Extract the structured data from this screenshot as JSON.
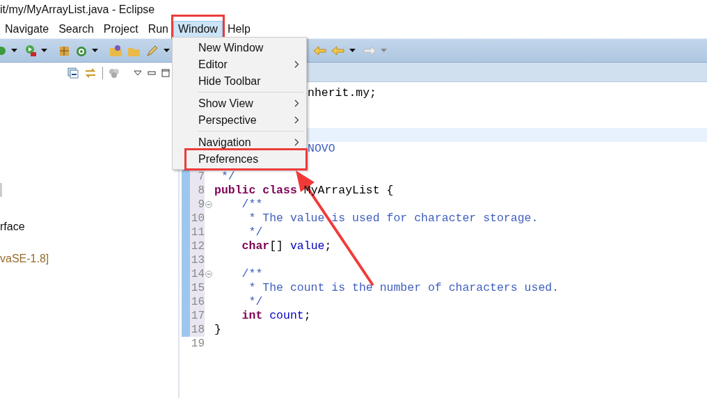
{
  "window": {
    "title": "it/my/MyArrayList.java - Eclipse"
  },
  "menu_bar": [
    {
      "label": "Navigate",
      "selected": false,
      "highlighted": false
    },
    {
      "label": "Search",
      "selected": false,
      "highlighted": false
    },
    {
      "label": "Project",
      "selected": false,
      "highlighted": false
    },
    {
      "label": "Run",
      "selected": false,
      "highlighted": false
    },
    {
      "label": "Window",
      "selected": true,
      "highlighted": true
    },
    {
      "label": "Help",
      "selected": false,
      "highlighted": false
    }
  ],
  "window_menu": [
    {
      "kind": "item",
      "label": "New Window",
      "submenu": false,
      "highlighted": false
    },
    {
      "kind": "item",
      "label": "Editor",
      "submenu": true,
      "highlighted": false
    },
    {
      "kind": "item",
      "label": "Hide Toolbar",
      "submenu": false,
      "highlighted": false
    },
    {
      "kind": "separator"
    },
    {
      "kind": "item",
      "label": "Show View",
      "submenu": true,
      "highlighted": false
    },
    {
      "kind": "item",
      "label": "Perspective",
      "submenu": true,
      "highlighted": false
    },
    {
      "kind": "separator"
    },
    {
      "kind": "item",
      "label": "Navigation",
      "submenu": true,
      "highlighted": false
    },
    {
      "kind": "item",
      "label": "Preferences",
      "submenu": false,
      "highlighted": true
    }
  ],
  "package_explorer": {
    "items": [
      {
        "label": "rface",
        "kind": "type"
      },
      {
        "label": "vaSE-1.8]",
        "kind": "library"
      }
    ]
  },
  "editor": {
    "lines": [
      {
        "current": false,
        "tokens": [
          {
            "t": "nherit.my;",
            "kind": "plain"
          }
        ]
      },
      {
        "current": false
      },
      {
        "current": false
      },
      {
        "current": true
      },
      {
        "current": false,
        "tokens": [
          {
            "t": "NOVO",
            "kind": "comment"
          }
        ]
      },
      {
        "current": false
      },
      {
        "number": "7",
        "current": false,
        "changed": true,
        "fold": false,
        "tokens": [
          {
            "t": " */",
            "kind": "comment"
          }
        ]
      },
      {
        "number": "8",
        "current": false,
        "changed": true,
        "fold": false,
        "tokens": [
          {
            "t": "public class",
            "kind": "kw"
          },
          {
            "t": " MyArrayList {",
            "kind": "plain"
          }
        ]
      },
      {
        "number": "9",
        "current": false,
        "changed": true,
        "fold": true,
        "tokens": [
          {
            "t": "    /**",
            "kind": "comment"
          }
        ]
      },
      {
        "number": "10",
        "current": false,
        "changed": true,
        "fold": false,
        "tokens": [
          {
            "t": "     * The value is used for character storage.",
            "kind": "comment"
          }
        ]
      },
      {
        "number": "11",
        "current": false,
        "changed": true,
        "fold": false,
        "tokens": [
          {
            "t": "     */",
            "kind": "comment"
          }
        ]
      },
      {
        "number": "12",
        "current": false,
        "changed": true,
        "fold": false,
        "tokens": [
          {
            "t": "    char",
            "kind": "kw"
          },
          {
            "t": "[] ",
            "kind": "plain"
          },
          {
            "t": "value",
            "kind": "field"
          },
          {
            "t": ";",
            "kind": "plain"
          }
        ]
      },
      {
        "number": "13",
        "current": false,
        "changed": true,
        "fold": false
      },
      {
        "number": "14",
        "current": false,
        "changed": true,
        "fold": true,
        "tokens": [
          {
            "t": "    /**",
            "kind": "comment"
          }
        ]
      },
      {
        "number": "15",
        "current": false,
        "changed": true,
        "fold": false,
        "tokens": [
          {
            "t": "     * The count is the number of characters used.",
            "kind": "comment"
          }
        ]
      },
      {
        "number": "16",
        "current": false,
        "changed": true,
        "fold": false,
        "tokens": [
          {
            "t": "     */",
            "kind": "comment"
          }
        ]
      },
      {
        "number": "17",
        "current": false,
        "changed": true,
        "fold": false,
        "tokens": [
          {
            "t": "    int",
            "kind": "kw"
          },
          {
            "t": " count",
            "kind": "field"
          },
          {
            "t": ";",
            "kind": "plain"
          }
        ]
      },
      {
        "number": "18",
        "current": false,
        "changed": true,
        "fold": false,
        "tokens": [
          {
            "t": "}",
            "kind": "plain"
          }
        ]
      },
      {
        "number": "19",
        "current": false,
        "changed": false,
        "fold": false
      }
    ]
  },
  "annotation_arrow": true
}
